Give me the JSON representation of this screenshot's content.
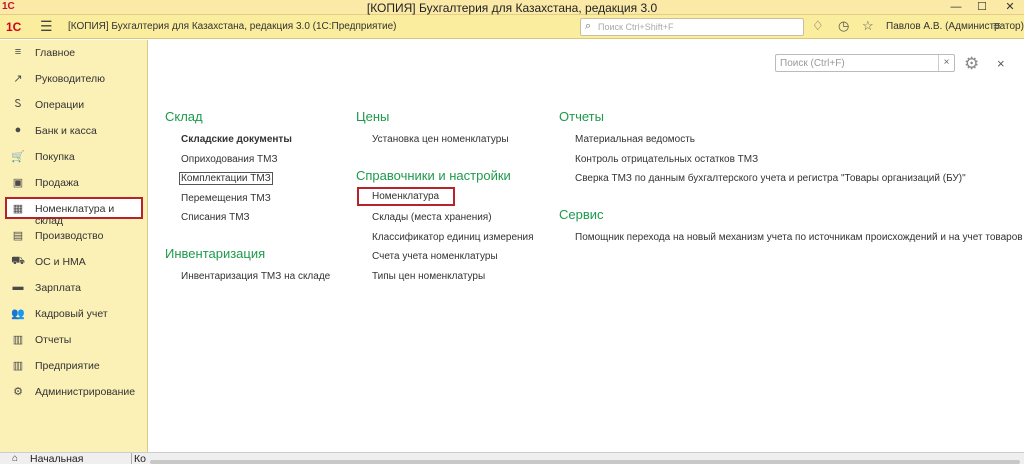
{
  "window": {
    "title": "[КОПИЯ] Бухгалтерия для Казахстана, редакция 3.0",
    "logo": "1С",
    "controls": [
      "—",
      "☐",
      "✕"
    ]
  },
  "appbar": {
    "logo": "1С",
    "app_title": "[КОПИЯ] Бухгалтерия для Казахстана, редакция 3.0  (1С:Предприятие)",
    "search_placeholder": "Поиск Ctrl+Shift+F",
    "user": "Павлов А.В. (Администратор)"
  },
  "sidebar": {
    "items": [
      {
        "label": "Главное",
        "icon": "list-icon",
        "glyph": "≡"
      },
      {
        "label": "Руководителю",
        "icon": "trend-icon",
        "glyph": "↗"
      },
      {
        "label": "Операции",
        "icon": "operations-icon",
        "glyph": "Ꮪ"
      },
      {
        "label": "Банк и касса",
        "icon": "money-icon",
        "glyph": "●"
      },
      {
        "label": "Покупка",
        "icon": "cart-icon",
        "glyph": "🛒"
      },
      {
        "label": "Продажа",
        "icon": "sale-icon",
        "glyph": "▣"
      },
      {
        "label": "Номенклатура и склад",
        "icon": "grid-icon",
        "glyph": "▦"
      },
      {
        "label": "Производство",
        "icon": "production-icon",
        "glyph": "▤"
      },
      {
        "label": "ОС и НМА",
        "icon": "truck-icon",
        "glyph": "⛟"
      },
      {
        "label": "Зарплата",
        "icon": "salary-icon",
        "glyph": "▬"
      },
      {
        "label": "Кадровый учет",
        "icon": "people-icon",
        "glyph": "👥"
      },
      {
        "label": "Отчеты",
        "icon": "chart-icon",
        "glyph": "▥"
      },
      {
        "label": "Предприятие",
        "icon": "building-icon",
        "glyph": "▥"
      },
      {
        "label": "Администрирование",
        "icon": "gear-icon",
        "glyph": "⚙"
      }
    ],
    "active_index": 6
  },
  "main": {
    "search_placeholder": "Поиск (Ctrl+F)",
    "clear": "×",
    "close": "×",
    "sections": {
      "sklad": {
        "title": "Склад",
        "items": [
          "Складские документы",
          "Оприходования ТМЗ",
          "Комплектации ТМЗ",
          "Перемещения ТМЗ",
          "Списания ТМЗ"
        ]
      },
      "inventar": {
        "title": "Инвентаризация",
        "items": [
          "Инвентаризация ТМЗ на складе"
        ]
      },
      "ceny": {
        "title": "Цены",
        "items": [
          "Установка цен номенклатуры"
        ]
      },
      "sprav": {
        "title": "Справочники и настройки",
        "items": [
          "Номенклатура",
          "Склады (места хранения)",
          "Классификатор единиц измерения",
          "Счета учета номенклатуры",
          "Типы цен номенклатуры"
        ]
      },
      "otchety": {
        "title": "Отчеты",
        "items": [
          "Материальная ведомость",
          "Контроль отрицательных остатков ТМЗ",
          "Сверка ТМЗ по данным бухгалтерского учета и регистра \"Товары организаций (БУ)\""
        ]
      },
      "servis": {
        "title": "Сервис",
        "items": [
          "Помощник перехода на новый механизм учета по источникам происхождений и на учет товаров Б"
        ]
      }
    }
  },
  "bottombar": {
    "tabs": [
      "Начальная страница",
      "Ко"
    ]
  }
}
